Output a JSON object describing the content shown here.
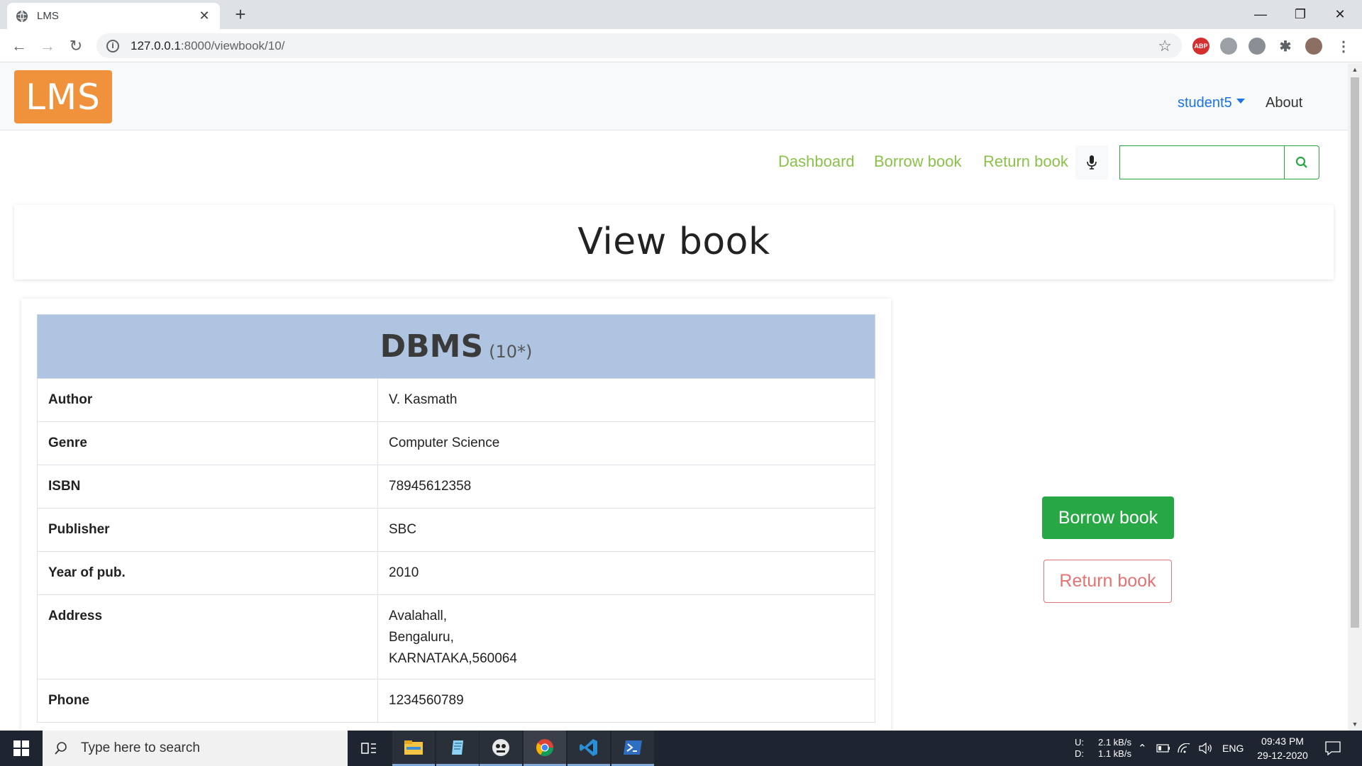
{
  "browser": {
    "tab_title": "LMS",
    "url_host": "127.0.0.1",
    "url_path": ":8000/viewbook/10/",
    "minimize": "—",
    "restore": "❐",
    "close": "✕",
    "abp_label": "ABP"
  },
  "navbar": {
    "logo": "LMS",
    "user": "student5",
    "about": "About"
  },
  "subnav": {
    "dashboard": "Dashboard",
    "borrow": "Borrow book",
    "return": "Return book",
    "search_value": ""
  },
  "page": {
    "title": "View book"
  },
  "book": {
    "title": "DBMS",
    "count": "(10*)",
    "fields": [
      {
        "label": "Author",
        "value": "V. Kasmath"
      },
      {
        "label": "Genre",
        "value": "Computer Science"
      },
      {
        "label": "ISBN",
        "value": "78945612358"
      },
      {
        "label": "Publisher",
        "value": "SBC"
      },
      {
        "label": "Year of pub.",
        "value": "2010"
      },
      {
        "label": "Address",
        "lines": [
          "Avalahall,",
          "Bengaluru,",
          "KARNATAKA,560064"
        ]
      },
      {
        "label": "Phone",
        "value": "1234560789"
      }
    ]
  },
  "actions": {
    "borrow": "Borrow book",
    "return": "Return book"
  },
  "taskbar": {
    "search_placeholder": "Type here to search",
    "net_up_label": "U:",
    "net_down_label": "D:",
    "net_up": "2.1 kB/s",
    "net_down": "1.1 kB/s",
    "lang": "ENG",
    "time": "09:43 PM",
    "date": "29-12-2020"
  },
  "colors": {
    "accent_green": "#28a745",
    "link_green": "#8ac249",
    "book_header": "#aec4e0",
    "logo_orange": "#f0913c",
    "return_red": "#e57373"
  }
}
